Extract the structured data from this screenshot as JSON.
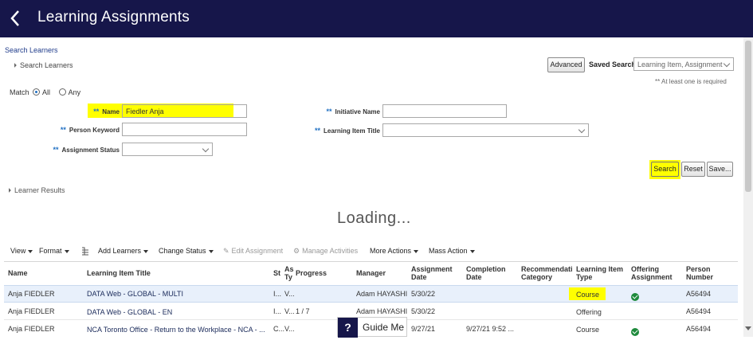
{
  "header": {
    "title": "Learning Assignments"
  },
  "search_section": {
    "breadcrumb": "Search Learners",
    "title": "Search Learners",
    "advanced_label": "Advanced",
    "saved_search_label": "Saved Search",
    "saved_search_value": "Learning Item, Assignment",
    "required_note": "** At least one is required",
    "match_label": "Match",
    "match_options": [
      "All",
      "Any"
    ],
    "required_marker": "**",
    "fields": {
      "name_label": "Name",
      "name_value": "Fiedler Anja",
      "person_keyword_label": "Person Keyword",
      "assignment_status_label": "Assignment Status",
      "initiative_name_label": "Initiative Name",
      "learning_item_title_label": "Learning Item Title"
    },
    "buttons": {
      "search": "Search",
      "reset": "Reset",
      "save": "Save..."
    }
  },
  "results": {
    "title": "Learner Results",
    "loading": "Loading...",
    "toolbar": {
      "view": "View",
      "format": "Format",
      "add_learners": "Add Learners",
      "change_status": "Change Status",
      "edit_assignment": "Edit Assignment",
      "manage_activities": "Manage Activities",
      "more_actions": "More Actions",
      "mass_action": "Mass Action"
    },
    "columns": [
      "Name",
      "Learning Item Title",
      "St",
      "As Ty",
      "Progress",
      "Manager",
      "Assignment Date",
      "Completion Date",
      "Recommendati Category",
      "Learning Item Type",
      "Offering Assignment",
      "Person Number"
    ],
    "rows": [
      {
        "name": "Anja FIEDLER",
        "title": "DATA Web - GLOBAL - MULTI",
        "st": "I...",
        "as": "V...",
        "progress": "",
        "manager": "Adam HAYASHI",
        "assign_date": "5/30/22",
        "completion": "",
        "category": "",
        "item_type": "Course",
        "offering": true,
        "person_number": "A56494"
      },
      {
        "name": "Anja FIEDLER",
        "title": "DATA Web - GLOBAL - EN",
        "st": "I...",
        "as": "V...",
        "progress": "1 / 7",
        "manager": "Adam HAYASHI",
        "assign_date": "5/30/22",
        "completion": "",
        "category": "",
        "item_type": "Offering",
        "offering": false,
        "person_number": "A56494"
      },
      {
        "name": "Anja FIEDLER",
        "title": "NCA Toronto Office - Return to the Workplace - NCA - ...",
        "st": "C...",
        "as": "V...",
        "progress": "",
        "manager": "",
        "assign_date": "9/27/21",
        "completion": "9/27/21 9:52 ...",
        "category": "",
        "item_type": "Course",
        "offering": true,
        "person_number": "A56494"
      }
    ]
  },
  "guide": {
    "q": "?",
    "label": "Guide Me"
  },
  "colors": {
    "header_bg": "#16164a",
    "highlight": "#ffff00",
    "link_blue": "#1f6fc2",
    "selected_row": "#e8f0fb",
    "success_green": "#1e8a3c"
  }
}
